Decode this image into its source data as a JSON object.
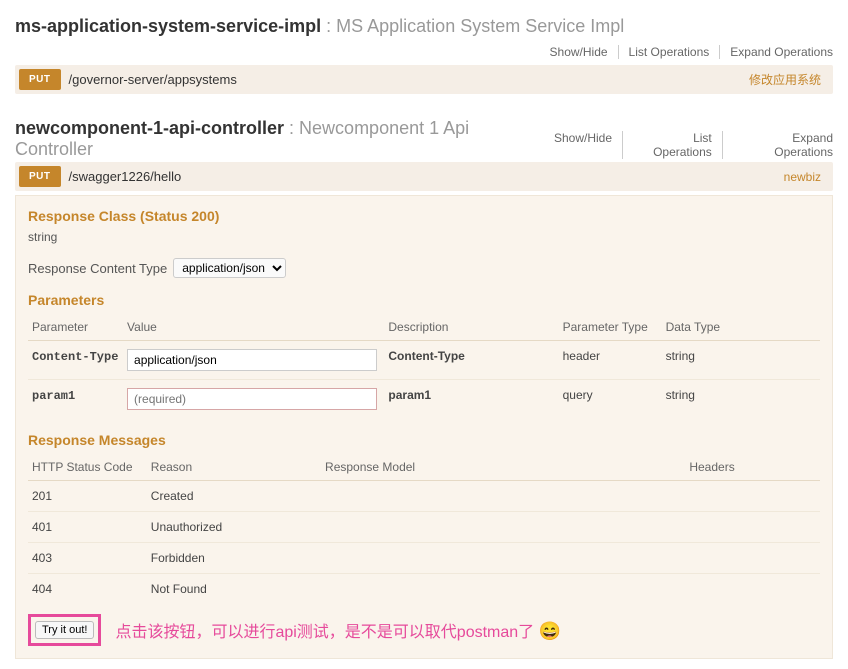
{
  "sections": [
    {
      "tag": "ms-application-system-service-impl",
      "desc": "MS Application System Service Impl",
      "actions": {
        "showhide": "Show/Hide",
        "list": "List Operations",
        "expand": "Expand Operations"
      },
      "endpoint": {
        "method": "PUT",
        "path": "/governor-server/appsystems",
        "summary": "修改应用系统"
      }
    },
    {
      "tag": "newcomponent-1-api-controller",
      "desc": "Newcomponent 1 Api Controller",
      "actions": {
        "showhide": "Show/Hide",
        "list": "List Operations",
        "expand": "Expand Operations"
      },
      "endpoint": {
        "method": "PUT",
        "path": "/swagger1226/hello",
        "summary": "newbiz"
      }
    }
  ],
  "panel": {
    "responseClassHeading": "Response Class (Status 200)",
    "responseClassType": "string",
    "contentTypeLabel": "Response Content Type",
    "contentTypeValue": "application/json",
    "parametersHeading": "Parameters",
    "paramHeaders": {
      "param": "Parameter",
      "value": "Value",
      "desc": "Description",
      "ptype": "Parameter Type",
      "dtype": "Data Type"
    },
    "params": [
      {
        "name": "Content-Type",
        "value": "application/json",
        "placeholder": "",
        "desc": "Content-Type",
        "ptype": "header",
        "dtype": "string",
        "required": false
      },
      {
        "name": "param1",
        "value": "",
        "placeholder": "(required)",
        "desc": "param1",
        "ptype": "query",
        "dtype": "string",
        "required": true
      }
    ],
    "respMsgHeading": "Response Messages",
    "respHeaders": {
      "code": "HTTP Status Code",
      "reason": "Reason",
      "model": "Response Model",
      "headers": "Headers"
    },
    "responses": [
      {
        "code": "201",
        "reason": "Created"
      },
      {
        "code": "401",
        "reason": "Unauthorized"
      },
      {
        "code": "403",
        "reason": "Forbidden"
      },
      {
        "code": "404",
        "reason": "Not Found"
      }
    ],
    "tryLabel": "Try it out!",
    "annotation": "点击该按钮，可以进行api测试，是不是可以取代postman了",
    "emoji": "😄"
  }
}
